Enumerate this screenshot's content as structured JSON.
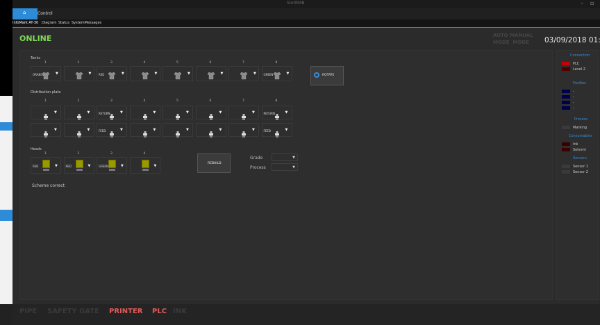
{
  "window": {
    "title": "SmtRMB"
  },
  "ribbon": {
    "control_tab": "Control"
  },
  "subtabs": [
    "InfoMark AT-30",
    "Diagram",
    "Status",
    "SystemMessages"
  ],
  "status": {
    "online": "ONLINE",
    "auto_label": "AUTO",
    "manual_label": "MANUAL",
    "mode_label": "MODE",
    "datetime": "03/09/2018 01:45"
  },
  "tanks": {
    "label": "Tanks",
    "numbers": [
      "1",
      "2",
      "3",
      "4",
      "5",
      "6",
      "7",
      "8"
    ],
    "colors": [
      "ORANGE",
      "",
      "RED",
      "",
      "",
      "",
      "",
      "GREEN"
    ]
  },
  "rotate_button": "ROTATE",
  "distribution": {
    "label": "Distribution plate",
    "numbers": [
      "1",
      "2",
      "3",
      "4",
      "5",
      "6",
      "7",
      "8"
    ],
    "row1": [
      "",
      "",
      "RETURN",
      "",
      "",
      "",
      "",
      "RETURN"
    ],
    "row2": [
      "",
      "",
      "FEED",
      "",
      "",
      "",
      "",
      "FEED"
    ]
  },
  "heads": {
    "label": "Heads",
    "numbers": [
      "1",
      "2",
      "3",
      "4"
    ],
    "colors": [
      "RED",
      "RED",
      "GREEN",
      ""
    ]
  },
  "rebuild_button": "REBUILD",
  "grade_label": "Grade",
  "process_label": "Process",
  "scheme_status": "Scheme correct",
  "right_panel": {
    "connection": "Connection",
    "plc": "PLC",
    "level2": "Level 2",
    "position": "Position",
    "position_items": [
      "-",
      "-",
      "-",
      "-"
    ],
    "process": "Process",
    "marking": "Marking",
    "consumables": "Consumables",
    "ink": "Ink",
    "solvent": "Solvent",
    "sensors": "Sensors",
    "sensor1": "Sensor 1",
    "sensor2": "Sensor 2"
  },
  "bottom": {
    "pipe": "PIPE",
    "safety_gate": "SAFETY GATE",
    "printer": "PRINTER",
    "plc": "PLC",
    "ink": "INK"
  },
  "colors": {
    "accent": "#2d8bd8",
    "online": "#7ed957",
    "alarm": "#e05a5a",
    "ink_head": "#9a9a00",
    "plc_red": "#cc0000"
  }
}
